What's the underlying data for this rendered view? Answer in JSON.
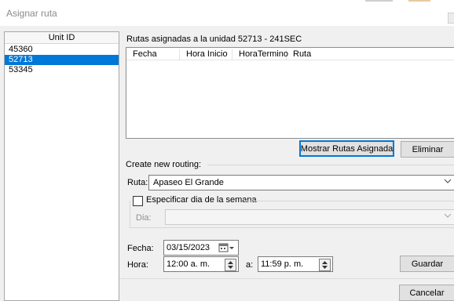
{
  "window": {
    "title": "Asignar ruta"
  },
  "units": {
    "header": "Unit ID",
    "items": [
      "45360",
      "52713",
      "53345"
    ],
    "selected_index": 1
  },
  "assigned": {
    "caption": "Rutas asignadas a la unidad 52713 - 241SEC",
    "columns": [
      "Fecha",
      "Hora Inicio",
      "HoraTermino",
      "Ruta"
    ]
  },
  "buttons": {
    "show_assigned": "Mostrar Rutas Asignada",
    "delete": "Eliminar",
    "save": "Guardar",
    "cancel": "Cancelar"
  },
  "new_routing": {
    "group_label": "Create new routing:",
    "route_label": "Ruta:",
    "route_value": "Apaseo El Grande",
    "weekday_checkbox_label": "Especificar dia de la semana",
    "weekday_checked": false,
    "day_label": "Dia:",
    "day_value": "",
    "date_label": "Fecha:",
    "date_value": "03/15/2023",
    "time_label": "Hora:",
    "time_from": "12:00 a. m.",
    "time_to_label": "a:",
    "time_to": "11:59 p. m."
  },
  "icons": {
    "dropdown": "chevron-down-icon",
    "calendar": "calendar-icon",
    "spinner": "spinner-updown-icon"
  },
  "colors": {
    "selection": "#0078d7",
    "button_bg": "#e1e1e1",
    "focus_border": "#0078d7"
  }
}
